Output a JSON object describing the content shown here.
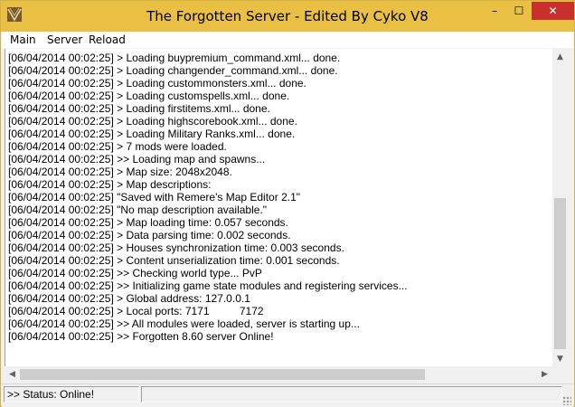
{
  "window": {
    "title": "The Forgotten Server - Edited By Cyko V8",
    "controls": {
      "minimize": "–",
      "maximize": "☐",
      "close": "✕"
    },
    "accent_color": "#e9c044",
    "close_color": "#c7302b"
  },
  "menu": {
    "items": [
      {
        "label": "Main"
      },
      {
        "label": "Server"
      },
      {
        "label": "Reload"
      }
    ]
  },
  "log": {
    "lines": [
      "[06/04/2014 00:02:25] > Loading buypremium_command.xml... done.",
      "[06/04/2014 00:02:25] > Loading changender_command.xml... done.",
      "[06/04/2014 00:02:25] > Loading custommonsters.xml... done.",
      "[06/04/2014 00:02:25] > Loading customspells.xml... done.",
      "[06/04/2014 00:02:25] > Loading firstitems.xml... done.",
      "[06/04/2014 00:02:25] > Loading highscorebook.xml... done.",
      "[06/04/2014 00:02:25] > Loading Military Ranks.xml... done.",
      "[06/04/2014 00:02:25] > 7 mods were loaded.",
      "[06/04/2014 00:02:25] >> Loading map and spawns...",
      "[06/04/2014 00:02:25] > Map size: 2048x2048.",
      "[06/04/2014 00:02:25] > Map descriptions:",
      "[06/04/2014 00:02:25] \"Saved with Remere's Map Editor 2.1\"",
      "[06/04/2014 00:02:25] \"No map description available.\"",
      "[06/04/2014 00:02:25] > Map loading time: 0.057 seconds.",
      "[06/04/2014 00:02:25] > Data parsing time: 0.002 seconds.",
      "[06/04/2014 00:02:25] > Houses synchronization time: 0.003 seconds.",
      "[06/04/2014 00:02:25] > Content unserialization time: 0.001 seconds.",
      "[06/04/2014 00:02:25] >> Checking world type... PvP",
      "[06/04/2014 00:02:25] >> Initializing game state modules and registering services...",
      "[06/04/2014 00:02:25] > Global address: 127.0.0.1",
      "[06/04/2014 00:02:25] > Local ports: 7171          7172",
      "[06/04/2014 00:02:25] >> All modules were loaded, server is starting up...",
      "[06/04/2014 00:02:25] >> Forgotten 8.60 server Online!"
    ]
  },
  "scrollbars": {
    "up_arrow": "▲",
    "down_arrow": "▼",
    "left_arrow": "◀",
    "right_arrow": "▶"
  },
  "status": {
    "text": ">> Status: Online!",
    "secondary": ""
  }
}
